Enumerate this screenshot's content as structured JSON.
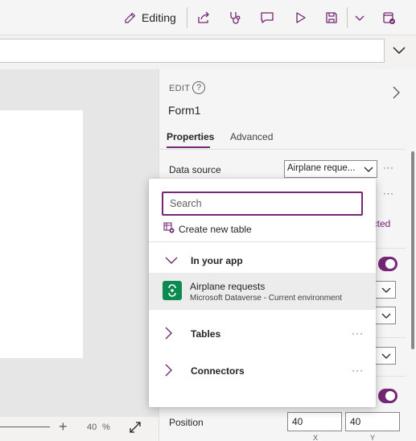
{
  "toolbar": {
    "editing_label": "Editing"
  },
  "canvas": {
    "zoom_value": "40",
    "zoom_unit": "%"
  },
  "properties_panel": {
    "edit_label": "EDIT",
    "help_glyph": "?",
    "control_name": "Form1",
    "tabs": [
      {
        "label": "Properties",
        "active": true
      },
      {
        "label": "Advanced",
        "active": false
      }
    ],
    "data_source_label": "Data source",
    "data_source_value": "Airplane reque...",
    "more_glyph": "···",
    "partial_text": "ected",
    "position_label": "Position",
    "position_x": "40",
    "position_y": "40",
    "position_x_label": "X",
    "position_y_label": "Y"
  },
  "datasource_popup": {
    "search_placeholder": "Search",
    "create_label": "Create new table",
    "sections": [
      {
        "label": "In your app",
        "expanded": true
      },
      {
        "label": "Tables",
        "expanded": false
      },
      {
        "label": "Connectors",
        "expanded": false
      }
    ],
    "items": [
      {
        "title": "Airplane requests",
        "subtitle": "Microsoft Dataverse - Current environment",
        "icon": "dataverse-icon",
        "selected": true
      }
    ],
    "more_glyph": "···"
  },
  "colors": {
    "accent": "#742774",
    "dataverse": "#0d8a51"
  }
}
